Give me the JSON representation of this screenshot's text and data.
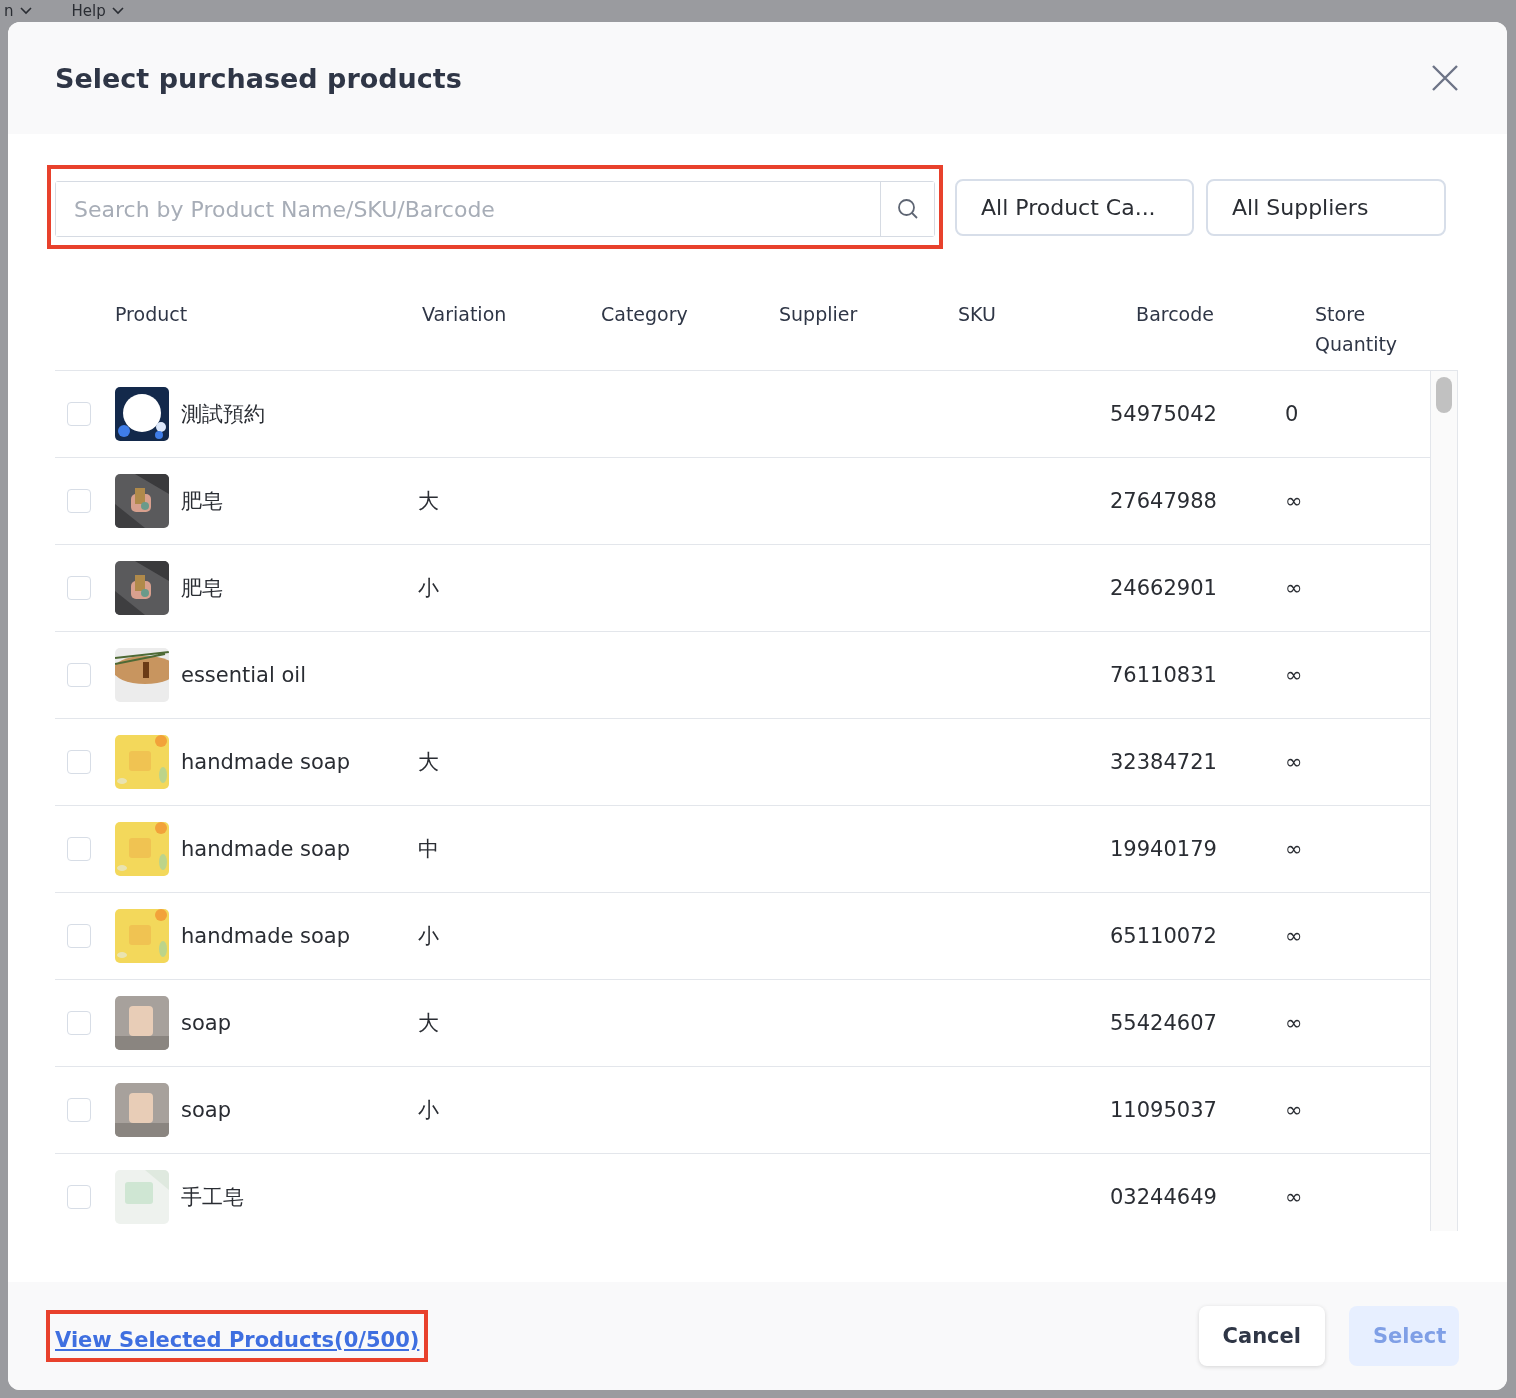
{
  "background_nav": [
    {
      "label": "n"
    },
    {
      "label": "Help"
    }
  ],
  "dialog": {
    "title": "Select purchased products"
  },
  "search": {
    "placeholder": "Search by Product Name/SKU/Barcode"
  },
  "filters": [
    {
      "label": "All Product Ca..."
    },
    {
      "label": "All Suppliers"
    }
  ],
  "table": {
    "columns": [
      "Product",
      "Variation",
      "Category",
      "Supplier",
      "SKU",
      "Barcode",
      "Store Quantity"
    ],
    "rows": [
      {
        "checked": false,
        "product": "測試預約",
        "variation": "",
        "barcode": "54975042",
        "quantity": "0"
      },
      {
        "checked": false,
        "product": "肥皂",
        "variation": "大",
        "barcode": "27647988",
        "quantity": "∞"
      },
      {
        "checked": false,
        "product": "肥皂",
        "variation": "小",
        "barcode": "24662901",
        "quantity": "∞"
      },
      {
        "checked": false,
        "product": "essential oil",
        "variation": "",
        "barcode": "76110831",
        "quantity": "∞"
      },
      {
        "checked": false,
        "product": "handmade soap",
        "variation": "大",
        "barcode": "32384721",
        "quantity": "∞"
      },
      {
        "checked": false,
        "product": "handmade soap",
        "variation": "中",
        "barcode": "19940179",
        "quantity": "∞"
      },
      {
        "checked": false,
        "product": "handmade soap",
        "variation": "小",
        "barcode": "65110072",
        "quantity": "∞"
      },
      {
        "checked": false,
        "product": "soap",
        "variation": "大",
        "barcode": "55424607",
        "quantity": "∞"
      },
      {
        "checked": false,
        "product": "soap",
        "variation": "小",
        "barcode": "11095037",
        "quantity": "∞"
      },
      {
        "checked": false,
        "product": "手工皂",
        "variation": "",
        "barcode": "03244649",
        "quantity": "∞"
      }
    ]
  },
  "footer": {
    "link": "View Selected Products(0/500)",
    "buttons": [
      {
        "label": "Cancel",
        "kind": "secondary",
        "disabled": false
      },
      {
        "label": "Select",
        "kind": "primary",
        "disabled": true
      }
    ]
  }
}
